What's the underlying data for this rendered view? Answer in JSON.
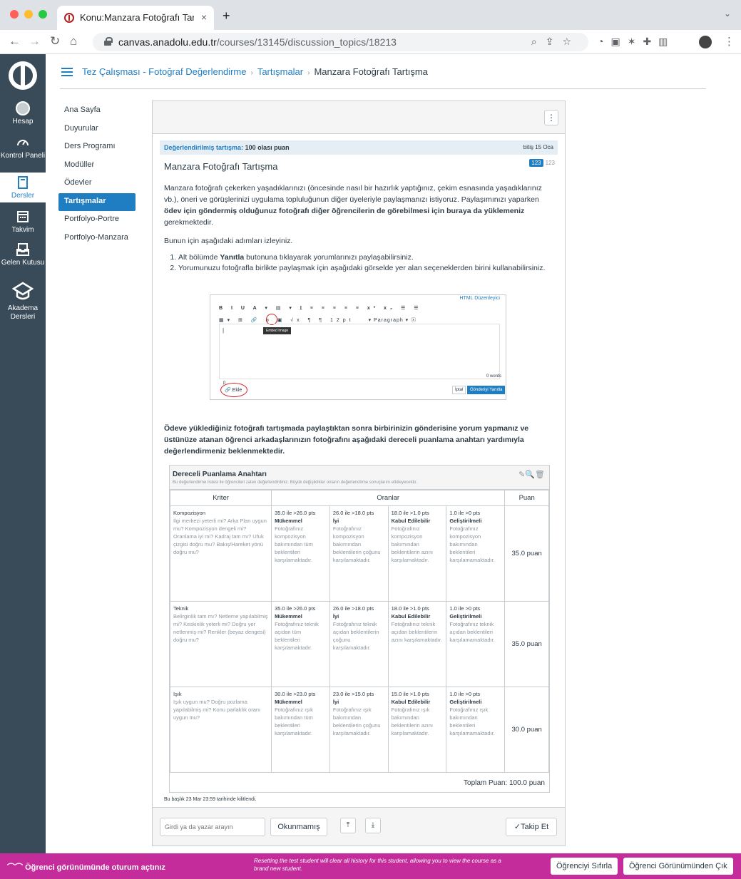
{
  "browser": {
    "tab_title": "Konu:Manzara Fotoğrafı Tartışr",
    "tab_close": "×",
    "new_tab": "+",
    "url_host": "canvas.anadolu.edu.tr",
    "url_path": "/courses/13145/discussion_topics/18213"
  },
  "global_nav": {
    "items": [
      {
        "label": "Hesap"
      },
      {
        "label": "Kontrol Paneli"
      },
      {
        "label": "Dersler"
      },
      {
        "label": "Takvim"
      },
      {
        "label": "Gelen Kutusu"
      },
      {
        "label": "Akadema Dersleri"
      }
    ]
  },
  "breadcrumb": {
    "course": "Tez Çalışması - Fotoğraf Değerlendirme",
    "section": "Tartışmalar",
    "current": "Manzara Fotoğrafı Tartışma"
  },
  "course_nav": {
    "items": [
      "Ana Sayfa",
      "Duyurular",
      "Ders Programı",
      "Modüller",
      "Ödevler",
      "Tartışmalar",
      "Portfolyo-Portre",
      "Portfolyo-Manzara"
    ],
    "active": "Tartışmalar"
  },
  "discussion": {
    "graded_label": "Değerlendirilmiş tartışma:",
    "graded_points": "100 olası puan",
    "due": "bitiş 15 Oca",
    "badge_a": "123",
    "badge_b": "123",
    "title": "Manzara Fotoğrafı Tartışma",
    "para1_a": "Manzara fotoğrafı çekerken yaşadıklarınızı (öncesinde nasıl bir hazırlık yaptığınız, çekim esnasında yaşadıklarınız vb.), öneri ve görüşlerinizi uygulama topluluğunun diğer üyeleriyle paylaşmanızı istiyoruz. Paylaşımınızı yaparken ",
    "para1_b": "ödev için göndermiş olduğunuz fotoğrafı diğer öğrencilerin de görebilmesi için buraya da yüklemeniz",
    "para1_c": " gerekmektedir.",
    "para2": "Bunun için aşağıdaki adımları izleyiniz.",
    "step1_a": "Alt bölümde ",
    "step1_b": "Yanıtla",
    "step1_c": " butonuna tıklayarak yorumlarınızı paylaşabilirsiniz.",
    "step2": "Yorumunuzu fotoğrafla birlikte paylaşmak için aşağıdaki görselde yer alan seçeneklerden birini kullanabilirsiniz.",
    "para3": "Ödeve yüklediğiniz fotoğrafı tartışmada paylaştıktan sonra birbirinizin gönderisine yorum yapmanız ve üstünüze atanan öğrenci arkadaşlarınızın fotoğrafını aşağıdaki dereceli puanlama anahtarı yardımıyla değerlendirmeniz beklenmektedir.",
    "locked_note": "Bu başlık 23 Mar 23:59 tarihinde kilitlendi."
  },
  "editor_image": {
    "html_editor": "HTML Düzenleyici",
    "row1": "B I U A ▾ ▤ ▾ I̲ ≡ ≡ ≡ ≡ ≡ x² x₂ ☰ ☰",
    "row2": "▦▾ ⊞ 🔗 ⌀ ▣ √x ¶ ¶ 12pt",
    "paragraph": "▾ Paragraph ▾ ⓧ",
    "tooltip": "Embed Image",
    "words": "0 words",
    "p": "p",
    "ekle": "🔗 Ekle",
    "cancel": "İptal",
    "submit": "Gönderiyi Yanıtla"
  },
  "rubric": {
    "title": "Dereceli Puanlama Anahtarı",
    "subtitle": "Bu değerlendirme listesi ile öğrencileri zaten değerlendirdiniz. Büyük değişiklikler onların değerlendirme sonuçlarını etkileyecektir.",
    "tools": "✎🔍🗑",
    "col_criteria": "Kriter",
    "col_ratings": "Oranlar",
    "col_points": "Puan",
    "rows": [
      {
        "name": "Kompozisyon",
        "desc": "İlgi merkezi yeterli mi? Arka Plan uygun mu? Kompozisyon dengeli mi? Oranlama iyi mi? Kadraj tam mı? Ufuk çizgisi doğru mu? Bakış/Hareket yönü doğru mu?",
        "ratings": [
          {
            "pts": "35.0 ile >26.0 pts",
            "name": "Mükemmel",
            "desc": "Fotoğrafınız kompozisyon bakımından tüm beklentileri karşılamaktadır."
          },
          {
            "pts": "26.0 ile >18.0 pts",
            "name": "İyi",
            "desc": "Fotoğrafınız kompozisyon bakımından beklentilerin çoğunu karşılamaktadır."
          },
          {
            "pts": "18.0 ile >1.0 pts",
            "name": "Kabul Edilebilir",
            "desc": "Fotoğrafınız kompozisyon bakımından beklentilerin azını karşılamaktadır."
          },
          {
            "pts": "1.0 ile >0 pts",
            "name": "Geliştirilmeli",
            "desc": "Fotoğrafınız kompozisyon bakımından beklentileri karşılamamaktadır."
          }
        ],
        "points": "35.0 puan"
      },
      {
        "name": "Teknik",
        "desc": "Belirginlik tam mı? Netleme yapılabilmiş mi? Keskinlik yeterli mi? Doğru yer netlenmiş mi? Renkler (beyaz dengesi) doğru mu?",
        "ratings": [
          {
            "pts": "35.0 ile >26.0 pts",
            "name": "Mükemmel",
            "desc": "Fotoğrafınız teknik açıdan tüm beklentileri karşılamaktadır."
          },
          {
            "pts": "26.0 ile >18.0 pts",
            "name": "İyi",
            "desc": "Fotoğrafınız teknik açıdan beklentilerin çoğunu karşılamaktadır."
          },
          {
            "pts": "18.0 ile >1.0 pts",
            "name": "Kabul Edilebilir",
            "desc": "Fotoğrafınız teknik açıdan beklentilerin azını karşılamaktadır."
          },
          {
            "pts": "1.0 ile >0 pts",
            "name": "Geliştirilmeli",
            "desc": "Fotoğrafınız teknik açıdan beklentileri karşılamamaktadır."
          }
        ],
        "points": "35.0 puan"
      },
      {
        "name": "Işık",
        "desc": "Işık uygun mu? Doğru pozlama yapılabilmiş mi? Konu parlaklık oranı uygun mu?",
        "ratings": [
          {
            "pts": "30.0 ile >23.0 pts",
            "name": "Mükemmel",
            "desc": "Fotoğrafınız ışık bakımından tüm beklentileri karşılamaktadır."
          },
          {
            "pts": "23.0 ile >15.0 pts",
            "name": "İyi",
            "desc": "Fotoğrafınız ışık bakımından beklentilerin çoğunu karşılamaktadır."
          },
          {
            "pts": "15.0 ile >1.0 pts",
            "name": "Kabul Edilebilir",
            "desc": "Fotoğrafınız ışık bakımından beklentilerin azını karşılamaktadır."
          },
          {
            "pts": "1.0 ile >0 pts",
            "name": "Geliştirilmeli",
            "desc": "Fotoğrafınız ışık bakımından beklentileri karşılamamaktadır."
          }
        ],
        "points": "30.0 puan"
      }
    ],
    "total": "Toplam Puan: 100.0 puan"
  },
  "toolbar": {
    "search_placeholder": "Girdi ya da yazar arayın",
    "unread": "Okunmamış",
    "expand": "⤒",
    "collapse": "⤓",
    "follow": "✓Takip Et"
  },
  "student_view": {
    "notice": "Öğrenci görünümünde oturum açtınız",
    "info": "Resetting the test student will clear all history for this student, allowing you to view the course as a brand new student.",
    "reset": "Öğrenciyi Sıfırla",
    "leave": "Öğrenci Görünümünden Çık"
  },
  "colors": {
    "canvas_blue": "#1f7ec2",
    "nav_dark": "#394b58",
    "student_view_pink": "#c42b9b"
  }
}
